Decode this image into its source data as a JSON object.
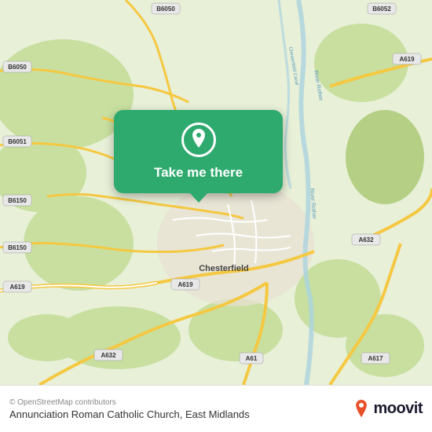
{
  "map": {
    "background_color": "#e8f0d8",
    "center_city": "Chesterfield"
  },
  "callout": {
    "label": "Take me there",
    "pin_icon": "location-pin"
  },
  "bottom_bar": {
    "copyright": "© OpenStreetMap contributors",
    "place_name": "Annunciation Roman Catholic Church, East Midlands",
    "moovit_text": "moovit"
  },
  "road_labels": {
    "b6050_top": "B6050",
    "b6050_left": "B6050",
    "b6051": "B6051",
    "b6150_top": "B6150",
    "b6150_mid": "B6150",
    "b6150_bot": "B6150",
    "a619_left": "A619",
    "a619_bot": "A619",
    "a632_bot": "A632",
    "a632_right": "A632",
    "a61": "A61",
    "a617": "A617",
    "a6052": "B6052",
    "chesterfield": "Chesterfield"
  },
  "colors": {
    "green_callout": "#2eaa6e",
    "road_yellow": "#f5c842",
    "road_white": "#ffffff",
    "water_blue": "#aad3df",
    "map_green": "#c8dfa0",
    "urban_beige": "#e8e0d4",
    "moovit_orange": "#e8502a",
    "moovit_dark": "#1a1a2e",
    "bottom_bg": "#ffffff"
  }
}
